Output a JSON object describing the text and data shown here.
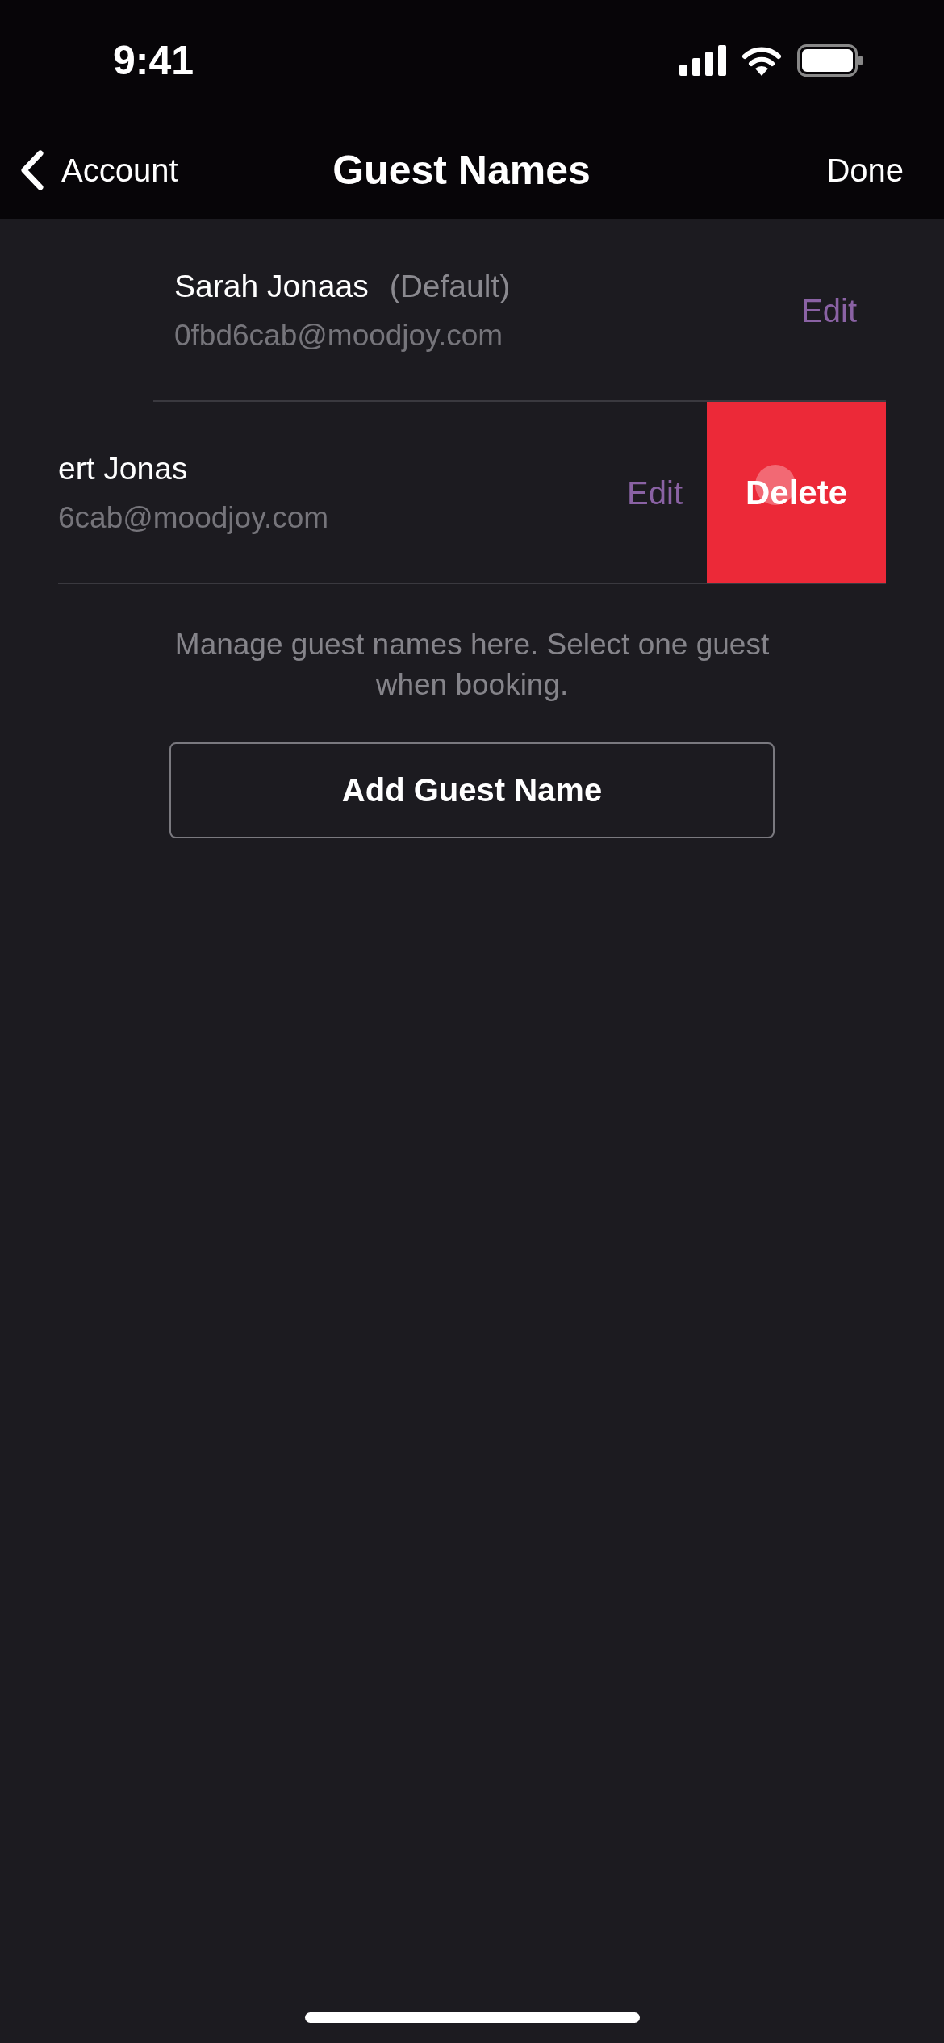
{
  "status_bar": {
    "time": "9:41"
  },
  "nav": {
    "back_label": "Account",
    "title": "Guest Names",
    "action": "Done"
  },
  "guests": [
    {
      "kind": "default",
      "name": "Sarah Jonaas",
      "tag": "(Default)",
      "email": "0fbd6cab@moodjoy.com",
      "edit": "Edit"
    },
    {
      "kind": "swiped",
      "name": "ert Jonas",
      "email": "6cab@moodjoy.com",
      "edit": "Edit",
      "delete": "Delete"
    }
  ],
  "hint": "Manage guest names here. Select one guest when booking.",
  "add_button": "Add Guest Name"
}
